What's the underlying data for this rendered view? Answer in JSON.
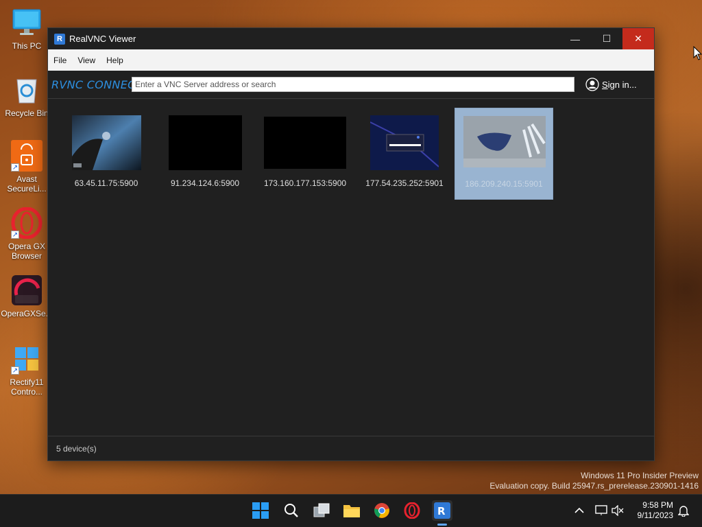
{
  "desktop": {
    "icons": [
      {
        "label": "This PC"
      },
      {
        "label": "Recycle Bin"
      },
      {
        "label": "Avast SecureLi..."
      },
      {
        "label": "Opera GX Browser"
      },
      {
        "label": "OperaGXSe..."
      },
      {
        "label": "Rectify11 Contro..."
      }
    ]
  },
  "window": {
    "title": "RealVNC Viewer",
    "controls": {
      "minimize": "—",
      "maximize": "☐",
      "close": "✕"
    },
    "menu": [
      "File",
      "View",
      "Help"
    ],
    "toolbar": {
      "brand": "RVNC CONNECT",
      "search_placeholder": "Enter a VNC Server address or search",
      "signin_label": "Sign in..."
    },
    "devices": [
      {
        "address": "63.45.11.75:5900",
        "selected": false
      },
      {
        "address": "91.234.124.6:5900",
        "selected": false
      },
      {
        "address": "173.160.177.153:5900",
        "selected": false
      },
      {
        "address": "177.54.235.252:5901",
        "selected": false
      },
      {
        "address": "186.209.240.15:5901",
        "selected": true
      }
    ],
    "status": "5 device(s)"
  },
  "watermark": {
    "line1": "Windows 11 Pro Insider Preview",
    "line2": "Evaluation copy. Build 25947.rs_prerelease.230901-1416"
  },
  "taskbar": {
    "apps": [
      "start-icon",
      "search-icon",
      "task-view-icon",
      "file-explorer-icon",
      "chrome-icon",
      "opera-gx-icon",
      "realvnc-icon"
    ],
    "clock_time": "9:58 PM",
    "clock_date": "9/11/2023"
  },
  "colors": {
    "accent": "#2d8fe0",
    "selection": "#99b4d1",
    "close": "#c42b1c"
  }
}
